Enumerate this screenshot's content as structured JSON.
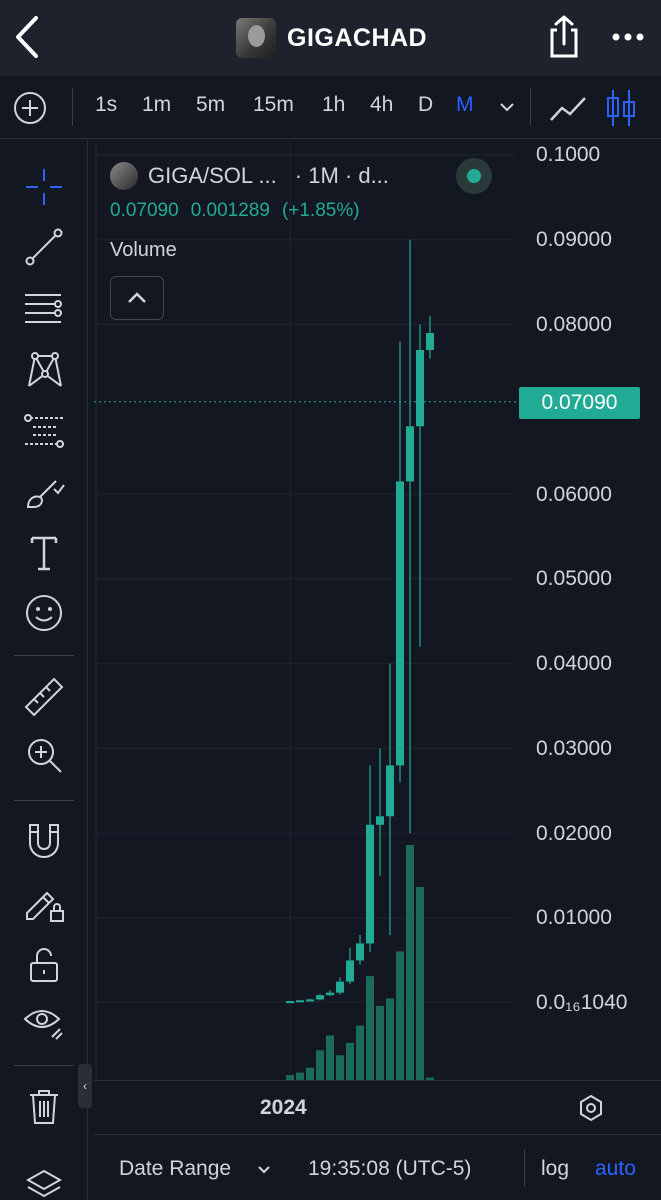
{
  "topbar": {
    "title": "GIGACHAD",
    "back_icon": "chevron-left-icon",
    "share_icon": "share-icon",
    "more_icon": "ellipsis-icon"
  },
  "intervals": [
    "1s",
    "1m",
    "5m",
    "15m",
    "1h",
    "4h",
    "D",
    "M"
  ],
  "active_interval": "M",
  "legend": {
    "symbol": "GIGA/SOL ...",
    "interval": "· 1M · d...",
    "price": "0.07090",
    "change": "0.001289",
    "change_pct": "(+1.85%)"
  },
  "volume_label": "Volume",
  "price_axis": [
    "0.1000",
    "0.09000",
    "0.08000",
    "0.06000",
    "0.05000",
    "0.04000",
    "0.03000",
    "0.02000",
    "0.01000",
    "0.0₁₆1040"
  ],
  "current_price_tag": "0.07090",
  "time_axis": {
    "year": "2024"
  },
  "bottombar": {
    "date_range": "Date Range",
    "clock": "19:35:08 (UTC-5)",
    "log": "log",
    "auto": "auto"
  },
  "colors": {
    "up": "#22ab94",
    "accent": "#2962ff",
    "background": "#131722"
  },
  "left_tools": [
    "crosshair-icon",
    "trend-line-icon",
    "horizontal-lines-icon",
    "pattern-icon",
    "fib-icon",
    "brush-icon",
    "text-icon",
    "emoji-icon",
    "ruler-icon",
    "zoom-in-icon",
    "magnet-icon",
    "pencil-lock-icon",
    "lock-icon",
    "eye-icon",
    "trash-icon",
    "layers-icon"
  ],
  "chart_data": {
    "type": "candlestick",
    "y_axis_ticks": [
      0.1,
      0.09,
      0.08,
      0.06,
      0.05,
      0.04,
      0.03,
      0.02,
      0.01
    ],
    "ylim": [
      0.0,
      0.1
    ],
    "candles": [
      {
        "o": 0.0001,
        "h": 0.0002,
        "l": 0.0001,
        "c": 0.0002
      },
      {
        "o": 0.0002,
        "h": 0.0003,
        "l": 0.0002,
        "c": 0.0003
      },
      {
        "o": 0.0003,
        "h": 0.0005,
        "l": 0.0002,
        "c": 0.0004
      },
      {
        "o": 0.0004,
        "h": 0.001,
        "l": 0.0003,
        "c": 0.0009
      },
      {
        "o": 0.0009,
        "h": 0.0015,
        "l": 0.0008,
        "c": 0.0012
      },
      {
        "o": 0.0012,
        "h": 0.003,
        "l": 0.001,
        "c": 0.0025
      },
      {
        "o": 0.0025,
        "h": 0.0065,
        "l": 0.0022,
        "c": 0.005
      },
      {
        "o": 0.005,
        "h": 0.008,
        "l": 0.0045,
        "c": 0.007
      },
      {
        "o": 0.007,
        "h": 0.028,
        "l": 0.006,
        "c": 0.021
      },
      {
        "o": 0.021,
        "h": 0.03,
        "l": 0.015,
        "c": 0.022
      },
      {
        "o": 0.022,
        "h": 0.04,
        "l": 0.008,
        "c": 0.028
      },
      {
        "o": 0.028,
        "h": 0.078,
        "l": 0.026,
        "c": 0.0615
      },
      {
        "o": 0.0615,
        "h": 0.09,
        "l": 0.02,
        "c": 0.068
      },
      {
        "o": 0.068,
        "h": 0.08,
        "l": 0.042,
        "c": 0.077
      },
      {
        "o": 0.077,
        "h": 0.081,
        "l": 0.076,
        "c": 0.079
      }
    ],
    "volume": [
      2,
      3,
      5,
      12,
      18,
      10,
      15,
      22,
      42,
      30,
      33,
      52,
      95,
      78,
      1
    ]
  }
}
